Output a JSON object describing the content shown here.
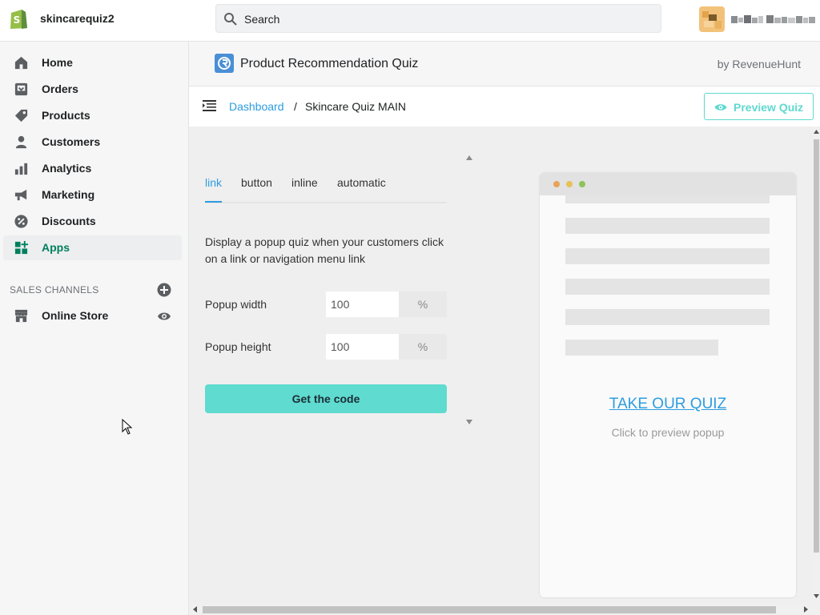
{
  "topbar": {
    "shop_name": "skincarequiz2",
    "search_placeholder": "Search"
  },
  "sidebar": {
    "items": [
      {
        "label": "Home",
        "icon": "home-icon"
      },
      {
        "label": "Orders",
        "icon": "orders-icon"
      },
      {
        "label": "Products",
        "icon": "tag-icon"
      },
      {
        "label": "Customers",
        "icon": "person-icon"
      },
      {
        "label": "Analytics",
        "icon": "bar-chart-icon"
      },
      {
        "label": "Marketing",
        "icon": "megaphone-icon"
      },
      {
        "label": "Discounts",
        "icon": "discount-icon"
      },
      {
        "label": "Apps",
        "icon": "apps-icon",
        "active": true
      }
    ],
    "channels_title": "SALES CHANNELS",
    "channels": [
      {
        "label": "Online Store",
        "icon": "store-icon"
      }
    ]
  },
  "app_header": {
    "title": "Product Recommendation Quiz",
    "by": "by RevenueHunt"
  },
  "toolbar": {
    "breadcrumb_link": "Dashboard",
    "breadcrumb_sep": "/",
    "breadcrumb_current": "Skincare Quiz MAIN",
    "preview_label": "Preview Quiz"
  },
  "panel": {
    "tabs": [
      "link",
      "button",
      "inline",
      "automatic"
    ],
    "active_tab": "link",
    "description": "Display a popup quiz when your customers click on a link or navigation menu link",
    "fields": [
      {
        "label": "Popup width",
        "value": "100",
        "unit": "%"
      },
      {
        "label": "Popup height",
        "value": "100",
        "unit": "%"
      }
    ],
    "get_code_label": "Get the code"
  },
  "preview": {
    "link_text": "TAKE OUR QUIZ",
    "sub_text": "Click to preview popup"
  },
  "colors": {
    "accent_teal": "#5fdbd0",
    "link_blue": "#2c9de0",
    "active_green": "#007f5f",
    "shopify_green": "#95bf47"
  }
}
